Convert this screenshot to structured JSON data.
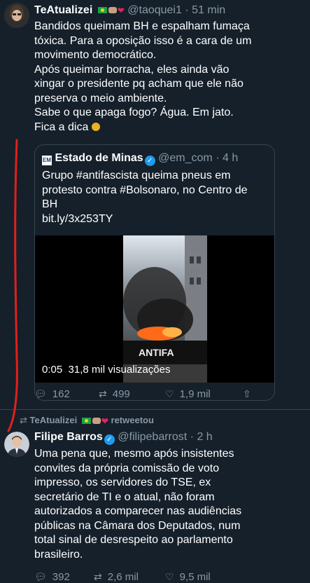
{
  "tweet1": {
    "name": "TeAtualizei",
    "handle": "@taoquei1",
    "time": "· 51 min",
    "lines": [
      "Bandidos queimam BH e espalham fumaça",
      "tóxica. Para a oposição isso é a cara de um",
      "movimento democrático.",
      "Após queimar borracha, eles ainda vão",
      "xingar o presidente pq acham que ele não",
      "preserva o meio ambiente.",
      "Sabe o que apaga fogo? Água. Em jato.",
      "Fica a dica"
    ],
    "quote": {
      "name": "Estado de Minas",
      "handle": "@em_com",
      "time": "· 4 h",
      "lines": [
        "Grupo #antifascista queima pneus em",
        "protesto contra #Bolsonaro, no Centro de",
        "BH",
        "bit.ly/3x253TY"
      ],
      "video_time": "0:05",
      "video_views": "31,8 mil visualizações",
      "banner_text": "ANTIFA"
    },
    "actions": {
      "replies": "162",
      "retweets": "499",
      "likes": "1,9 mil"
    }
  },
  "retweet_header": {
    "name": "TeAtualizei",
    "label": "retweetou"
  },
  "tweet2": {
    "name": "Filipe Barros",
    "handle": "@filipebarrost",
    "time": "· 2 h",
    "lines": [
      "Uma pena que, mesmo após insistentes",
      "convites da própria comissão de voto",
      "impresso, os servidores do TSE, ex",
      "secretário de TI e o atual, não foram",
      "autorizados a comparecer nas audiências",
      "públicas na Câmara dos Deputados, num",
      "total sinal de desrespeito ao parlamento",
      "brasileiro."
    ],
    "actions": {
      "replies": "392",
      "retweets": "2,6 mil",
      "likes": "9,5 mil"
    }
  },
  "colors": {
    "bg": "#15202b",
    "muted": "#8899a6",
    "annotation": "#e0201c",
    "verified": "#1d9bf0"
  }
}
